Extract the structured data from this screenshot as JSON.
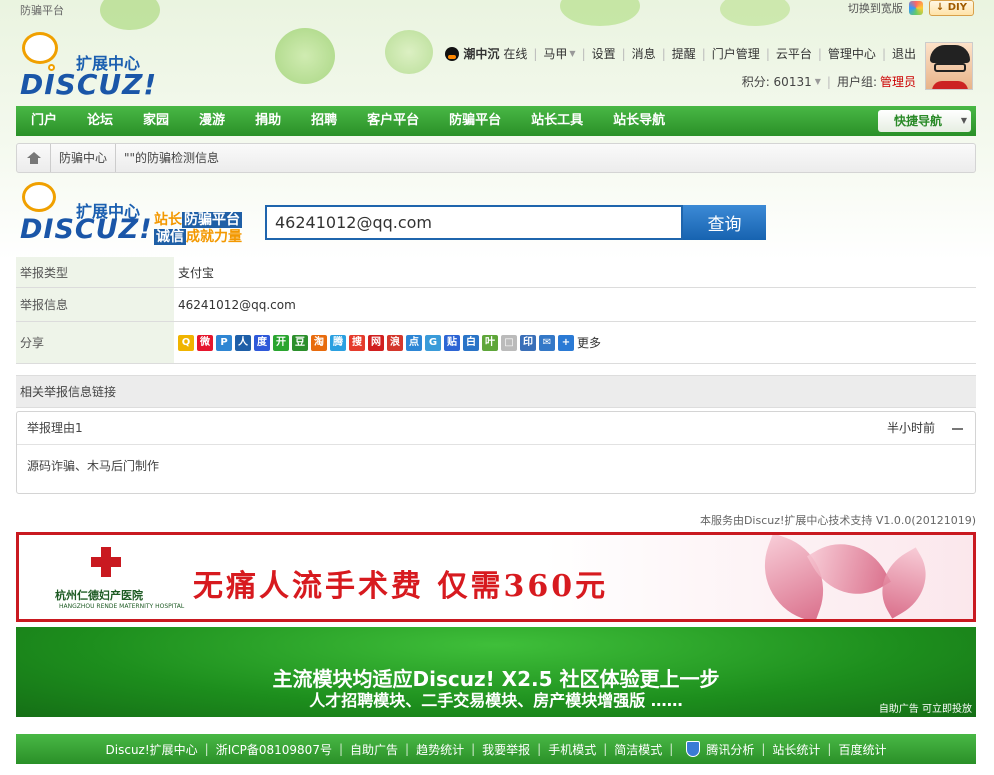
{
  "topbar": {
    "left_label": "防骗平台",
    "switch_label": "切换到宽版",
    "diy_label": "DIY"
  },
  "header": {
    "logo_title": "扩展中心",
    "logo_brand": "DISCUZ!",
    "user": {
      "name": "潮中沉",
      "status": "在线",
      "links": [
        "马甲",
        "设置",
        "消息",
        "提醒",
        "门户管理",
        "云平台",
        "管理中心",
        "退出"
      ],
      "points_label": "积分: 60131",
      "group_label": "用户组:",
      "group_value": "管理员"
    }
  },
  "nav": {
    "items": [
      "门户",
      "论坛",
      "家园",
      "漫游",
      "捐助",
      "招聘",
      "客户平台",
      "防骗平台",
      "站长工具",
      "站长导航"
    ],
    "quick_nav": "快捷导航"
  },
  "breadcrumb": {
    "items": [
      "防骗中心",
      "\"\"的防骗检测信息"
    ]
  },
  "search": {
    "logo_title": "扩展中心",
    "logo_brand": "DISCUZ!",
    "slogan_l1_a": "站长",
    "slogan_l1_b": "防骗平台",
    "slogan_l2_a": "诚信",
    "slogan_l2_b": "成就力量",
    "value": "46241012@qq.com",
    "button": "查询"
  },
  "info": {
    "type_label": "举报类型",
    "type_value": "支付宝",
    "info_label": "举报信息",
    "info_value": "46241012@qq.com",
    "share_label": "分享",
    "share_more": "更多",
    "share_icons": [
      {
        "name": "qzone",
        "glyph": "Q",
        "color": "#f0b400"
      },
      {
        "name": "weibo",
        "glyph": "微",
        "color": "#e6162d"
      },
      {
        "name": "pengyou",
        "glyph": "P",
        "color": "#2f86d3"
      },
      {
        "name": "renren",
        "glyph": "人",
        "color": "#1e5fa8"
      },
      {
        "name": "baidu",
        "glyph": "度",
        "color": "#2f59d9"
      },
      {
        "name": "kaixin",
        "glyph": "开",
        "color": "#2aa530"
      },
      {
        "name": "douban",
        "glyph": "豆",
        "color": "#2c8f2c"
      },
      {
        "name": "taobao",
        "glyph": "淘",
        "color": "#e86b0d"
      },
      {
        "name": "tqq",
        "glyph": "腾",
        "color": "#2ba0e0"
      },
      {
        "name": "sohu",
        "glyph": "搜",
        "color": "#e53b2c"
      },
      {
        "name": "163",
        "glyph": "网",
        "color": "#d11f1f"
      },
      {
        "name": "sina",
        "glyph": "浪",
        "color": "#d4372c"
      },
      {
        "name": "diandian",
        "glyph": "点",
        "color": "#2d86d5"
      },
      {
        "name": "google",
        "glyph": "G",
        "color": "#3a9bd9"
      },
      {
        "name": "tieba",
        "glyph": "贴",
        "color": "#2d65d4"
      },
      {
        "name": "baishehui",
        "glyph": "白",
        "color": "#2a74c7"
      },
      {
        "name": "leaf",
        "glyph": "叶",
        "color": "#5fa63a"
      },
      {
        "name": "copy",
        "glyph": "□",
        "color": "#bbbbbb"
      },
      {
        "name": "print",
        "glyph": "印",
        "color": "#3a6fb8"
      },
      {
        "name": "email",
        "glyph": "✉",
        "color": "#3478c7"
      },
      {
        "name": "add",
        "glyph": "+",
        "color": "#2a7ad5"
      }
    ]
  },
  "related": {
    "title": "相关举报信息链接",
    "reason_title": "举报理由1",
    "reason_time": "半小时前",
    "reason_body": "源码诈骗、木马后门制作"
  },
  "powered_by": "本服务由Discuz!扩展中心技术支持 V1.0.0(20121019)",
  "ads": {
    "hospital_name": "杭州仁德妇产医院",
    "hospital_tag": "HANGZHOU RENDE MATERNITY HOSPITAL",
    "headline": "无痛人流手术费 仅需360元",
    "promo_l1": "主流模块均适应Discuz! X2.5 社区体验更上一步",
    "promo_l2": "人才招聘模块、二手交易模块、房产模块增强版 ……",
    "promo_self": "自助广告 可立即投放"
  },
  "footer": {
    "items": [
      "Discuz!扩展中心",
      "浙ICP备08109807号",
      "自助广告",
      "趋势统计",
      "我要举报",
      "手机模式",
      "简洁模式"
    ],
    "items2": [
      "腾讯分析",
      "站长统计",
      "百度统计"
    ]
  },
  "colors": {
    "nav_green": "#2a9028",
    "brand_blue": "#1a56a8",
    "accent_orange": "#f39800",
    "ad_red": "#c91920"
  }
}
